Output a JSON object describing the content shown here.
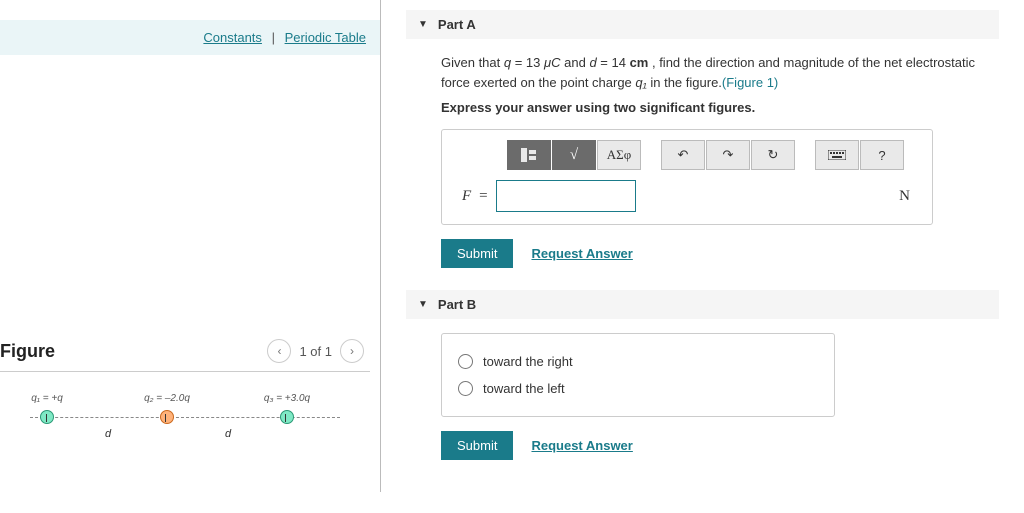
{
  "header_links": {
    "constants": "Constants",
    "periodic_table": "Periodic Table"
  },
  "figure": {
    "title": "Figure",
    "pager": "1 of 1",
    "labels": {
      "q1": "q₁ = +q",
      "q2": "q₂ = –2.0q",
      "q3": "q₃ = +3.0q",
      "d": "d"
    }
  },
  "partA": {
    "title": "Part A",
    "prompt_pre": "Given that ",
    "prompt_q": "q",
    "prompt_qval": " = 13 ",
    "prompt_qunit": "μC",
    "prompt_and": " and ",
    "prompt_d": "d",
    "prompt_dval": " = 14 ",
    "prompt_dunit": "cm",
    "prompt_post": " , find the direction and magnitude of the net electrostatic force exerted on the point charge ",
    "prompt_q1": "q₁",
    "prompt_end": " in the figure.",
    "fig_ref": "(Figure 1)",
    "instruct": "Express your answer using two significant figures.",
    "toolbar": {
      "greek": "ΑΣφ",
      "help": "?"
    },
    "var": "F",
    "eq": "=",
    "unit": "N",
    "submit": "Submit",
    "request": "Request Answer"
  },
  "partB": {
    "title": "Part B",
    "opt1": "toward the right",
    "opt2": "toward the left",
    "submit": "Submit",
    "request": "Request Answer"
  }
}
